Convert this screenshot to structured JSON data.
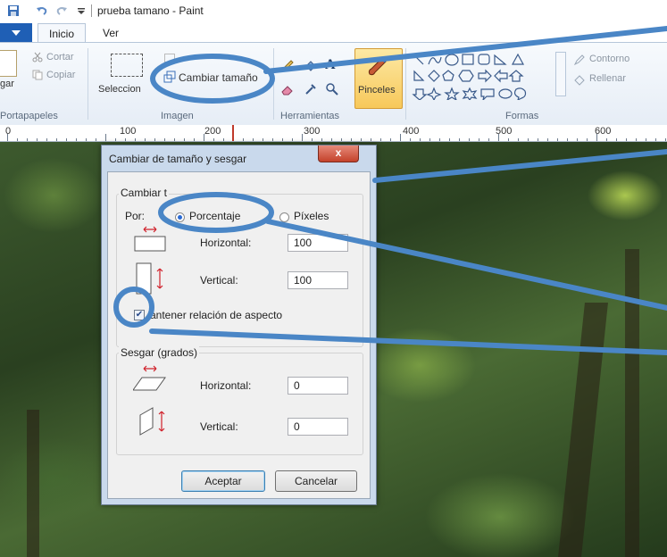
{
  "window": {
    "title": "prueba tamano - Paint"
  },
  "tabs": [
    {
      "label": "Inicio",
      "active": true
    },
    {
      "label": "Ver",
      "active": false
    }
  ],
  "ribbon": {
    "clipboard": {
      "cut": "Cortar",
      "copy": "Copiar",
      "paste": "gar",
      "label": "Portapapeles"
    },
    "image": {
      "select": "Seleccion",
      "resize": "Cambiar tamaño",
      "label": "Imagen"
    },
    "tools": {
      "label": "Herramientas",
      "text_tool": "A"
    },
    "brushes": {
      "label": "Pinceles"
    },
    "shapes": {
      "outline": "Contorno",
      "fill": "Rellenar",
      "label": "Formas"
    }
  },
  "ruler": {
    "ticks": [
      "0",
      "100",
      "200",
      "300",
      "400",
      "500",
      "600"
    ]
  },
  "dialog": {
    "title": "Cambiar de tamaño y sesgar",
    "close": "x",
    "resize_section": "Cambiar t",
    "by_label": "Por:",
    "percent_option": "Porcentaje",
    "pixels_option": "Píxeles",
    "horizontal_label": "Horizontal:",
    "horizontal_value": "100",
    "vertical_label": "Vertical:",
    "vertical_value": "100",
    "keep_ratio": "antener relación de aspecto",
    "keep_ratio_checked": true,
    "skew_section": "Sesgar (grados)",
    "skew_horizontal_label": "Horizontal:",
    "skew_horizontal_value": "0",
    "skew_vertical_label": "Vertical:",
    "skew_vertical_value": "0",
    "ok": "Aceptar",
    "cancel": "Cancelar"
  },
  "colors": {
    "annotation": "#4a86c6",
    "file_tab": "#1f5fb5",
    "ribbon_bg": "#eef3fa"
  }
}
